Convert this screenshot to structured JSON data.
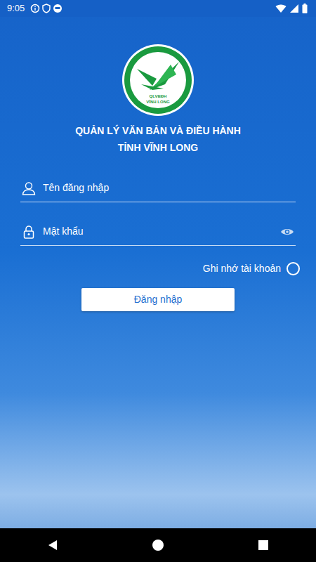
{
  "status_bar": {
    "time": "9:05"
  },
  "logo": {
    "line1": "QLVBĐH",
    "line2": "VĨNH LONG"
  },
  "title": {
    "lines": [
      "QUẢN LÝ VĂN BẢN VÀ ĐIỀU HÀNH",
      "TỈNH VĨNH LONG"
    ]
  },
  "username": {
    "placeholder": "Tên đăng nhập"
  },
  "password": {
    "placeholder": "Mật khẩu"
  },
  "remember": {
    "label": "Ghi nhớ tài khoản",
    "checked": false
  },
  "buttons": [
    "Đăng nhập"
  ]
}
